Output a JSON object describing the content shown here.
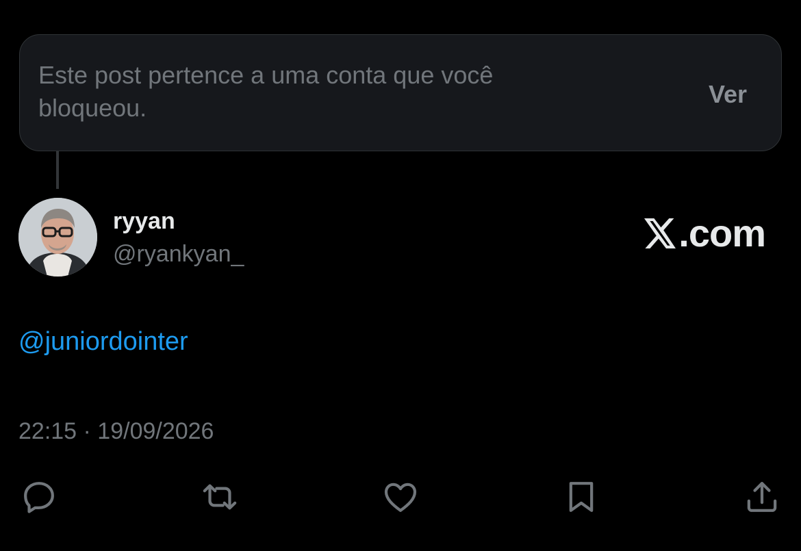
{
  "blocked_notice": {
    "text": "Este post pertence a uma conta que você bloqueou.",
    "action_label": "Ver"
  },
  "author": {
    "display_name": "ryyan",
    "handle": "@ryankyan_"
  },
  "watermark": "X.com",
  "post": {
    "mention": "@juniordointer",
    "timestamp": "22:15 · 19/09/2026"
  },
  "actions": [
    {
      "name": "reply",
      "icon": "reply-icon"
    },
    {
      "name": "repost",
      "icon": "repost-icon"
    },
    {
      "name": "like",
      "icon": "heart-icon"
    },
    {
      "name": "bookmark",
      "icon": "bookmark-icon"
    },
    {
      "name": "share",
      "icon": "share-icon"
    }
  ],
  "colors": {
    "background": "#000000",
    "card": "#16181c",
    "muted_text": "#71767b",
    "link": "#1d9bf0",
    "primary_text": "#e7e9ea"
  }
}
